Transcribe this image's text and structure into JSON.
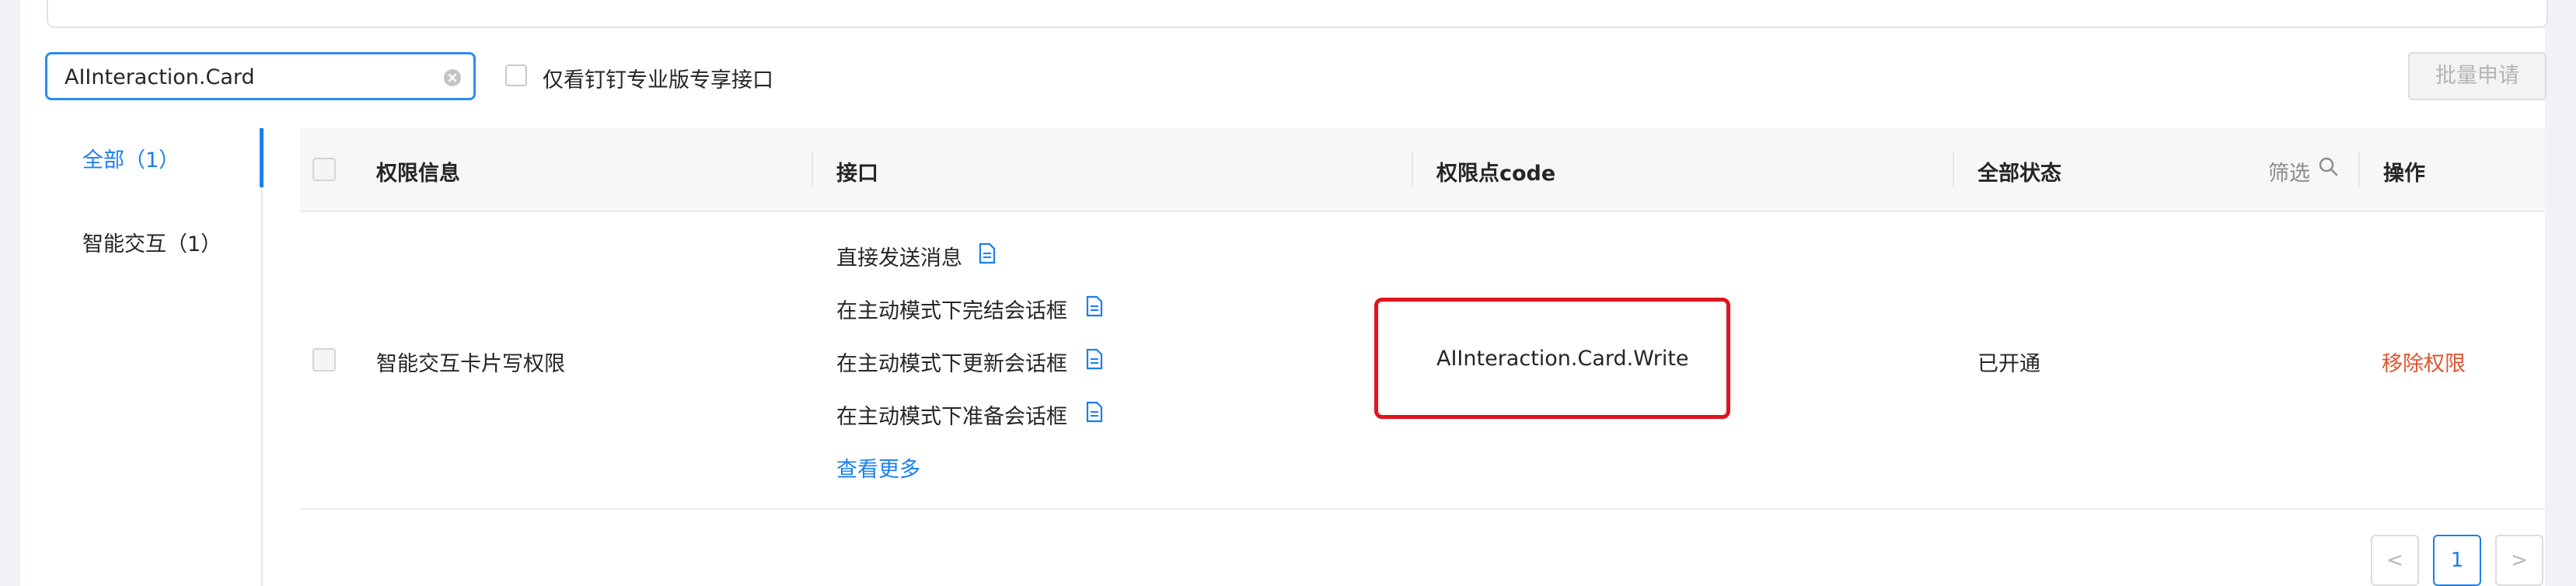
{
  "search": {
    "value": "AIInteraction.Card"
  },
  "filter_checkbox": {
    "label": "仅看钉钉专业版专享接口",
    "checked": false
  },
  "toolbar": {
    "batch_apply_label": "批量申请"
  },
  "sidebar": {
    "items": [
      {
        "label": "全部（1）",
        "active": true
      },
      {
        "label": "智能交互（1）",
        "active": false
      }
    ]
  },
  "table": {
    "headers": {
      "permission_info": "权限信息",
      "api": "接口",
      "code": "权限点code",
      "status": "全部状态",
      "filter": "筛选",
      "action": "操作"
    },
    "rows": [
      {
        "permission_info": "智能交互卡片写权限",
        "apis": [
          "直接发送消息",
          "在主动模式下完结会话框",
          "在主动模式下更新会话框",
          "在主动模式下准备会话框"
        ],
        "more_label": "查看更多",
        "code": "AIInteraction.Card.Write",
        "status": "已开通",
        "action": "移除权限"
      }
    ]
  },
  "pagination": {
    "prev": "<",
    "current": "1",
    "next": ">"
  },
  "colors": {
    "accent": "#1a7ff0",
    "danger": "#e0542e",
    "highlight": "#e0141e"
  }
}
